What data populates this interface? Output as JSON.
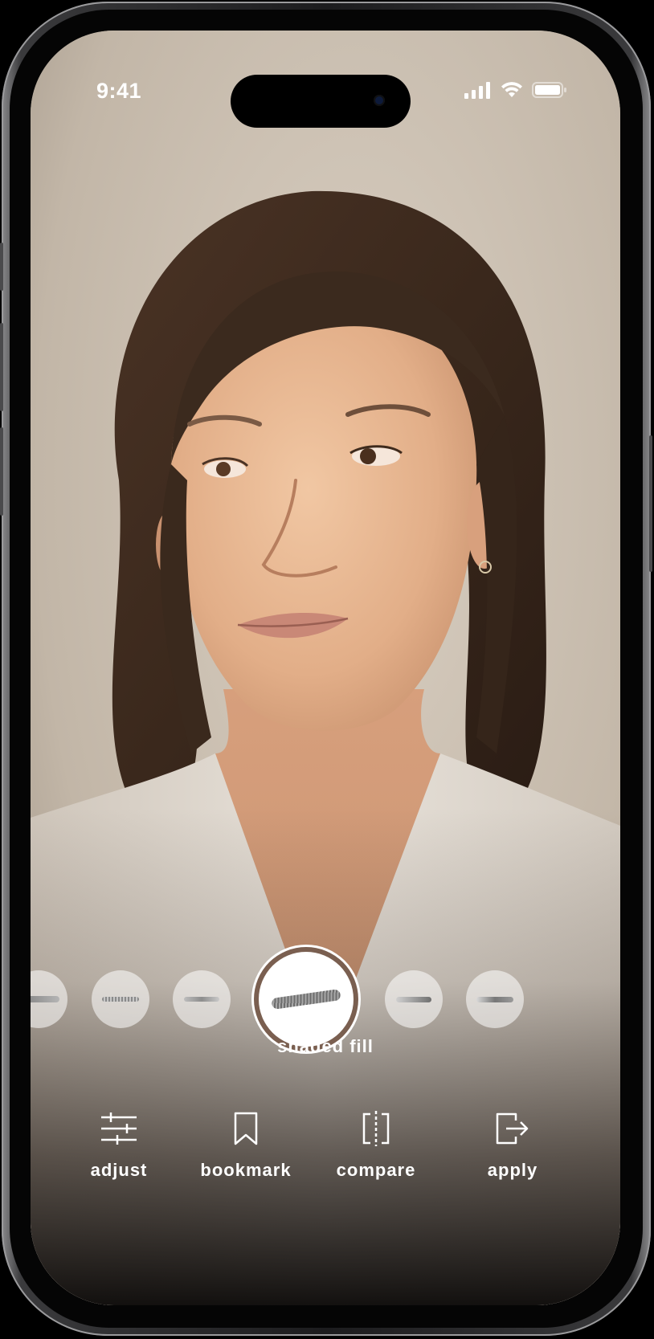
{
  "status_bar": {
    "time": "9:41",
    "icons": [
      "cellular-signal-icon",
      "wifi-icon",
      "battery-icon"
    ]
  },
  "camera": {
    "subject": "portrait-photo"
  },
  "brush_carousel": {
    "items": [
      {
        "name": "brush-1"
      },
      {
        "name": "brush-2"
      },
      {
        "name": "brush-3"
      },
      {
        "name": "brush-shaded-fill",
        "selected": true
      },
      {
        "name": "brush-5"
      },
      {
        "name": "brush-6"
      }
    ],
    "selected_label": "shaded fill"
  },
  "toolbar": {
    "adjust": {
      "label": "adjust",
      "icon": "sliders-icon"
    },
    "bookmark": {
      "label": "bookmark",
      "icon": "bookmark-icon"
    },
    "compare": {
      "label": "compare",
      "icon": "compare-icon"
    },
    "apply": {
      "label": "apply",
      "icon": "exit-arrow-icon"
    }
  },
  "colors": {
    "accent_ring": "#7a5f50",
    "text": "#ffffff"
  }
}
